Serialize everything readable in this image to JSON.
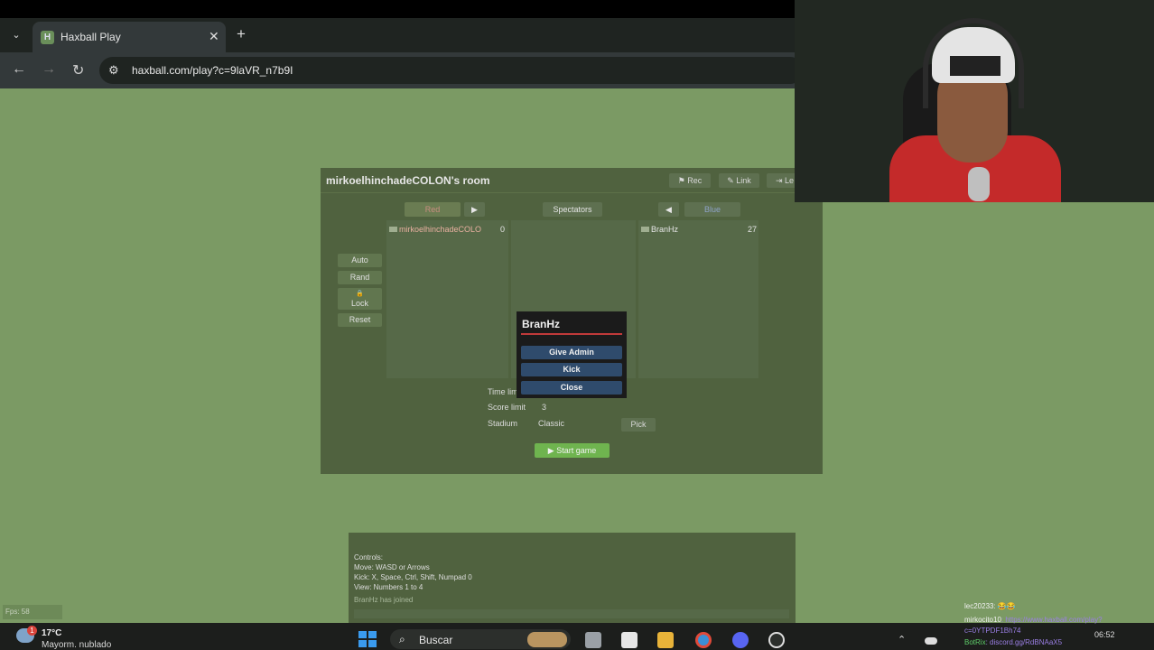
{
  "browser": {
    "tab_menu": "⌄",
    "tab_title": "Haxball Play",
    "tab_favicon": "H",
    "tab_close": "✕",
    "new_tab": "+",
    "back": "←",
    "forward": "→",
    "reload": "↻",
    "site_info_icon": "⚙",
    "url": "haxball.com/play?c=9laVR_n7b9I"
  },
  "room": {
    "title": "mirkoelhinchadeCOLON's room",
    "header_buttons": [
      "⚑ Rec",
      "✎ Link",
      "⇥ Le"
    ],
    "red_label": "Red",
    "red_arrow": "▶",
    "spectators_label": "Spectators",
    "blue_arrow": "◀",
    "blue_label": "Blue",
    "red_player": {
      "name": "mirkoelhinchadeCOLO",
      "number": "0"
    },
    "blue_player": {
      "name": "BranHz",
      "number": "27"
    },
    "side_buttons": {
      "auto": "Auto",
      "rand": "Rand",
      "lock_icon": "🔒",
      "lock": "Lock",
      "reset": "Reset"
    },
    "settings": {
      "time_label": "Time lim",
      "score_label": "Score limit",
      "score_value": "3",
      "stadium_label": "Stadium",
      "stadium_value": "Classic"
    },
    "pick_label": "Pick",
    "start_label": "▶ Start game"
  },
  "popup": {
    "title": "BranHz",
    "give_admin": "Give Admin",
    "kick": "Kick",
    "close": "Close"
  },
  "chat": {
    "lines": [
      "Controls:",
      "Move: WASD or Arrows",
      "Kick: X, Space, Ctrl, Shift, Numpad 0",
      "View: Numbers 1 to 4"
    ],
    "join_msg": "BranHz has joined"
  },
  "fps": "Fps: 58",
  "taskbar": {
    "weather_badge": "1",
    "temp": "17°C",
    "weather_desc": "Mayorm. nublado",
    "search_icon": "⌕",
    "search_placeholder": "Buscar",
    "tray_up": "⌃",
    "time": "06:52"
  },
  "stream_chat": [
    {
      "user": "lec20233",
      "msg": ": 😂😂"
    },
    {
      "user": "mirkocito10",
      "msg": ": https://www.haxball.com/play?"
    },
    {
      "user": "",
      "msg": "c=0YTPDF1Bh74"
    },
    {
      "user": "BotRix",
      "msg": ": discord.gg/RdBNAaX5"
    }
  ],
  "colors": {
    "page_bg": "#7b9a64",
    "room_bg": "#50623f",
    "popup_bg": "#1b1b1b",
    "popup_btn": "#2f4b6c",
    "start_btn": "#6fb44f"
  }
}
